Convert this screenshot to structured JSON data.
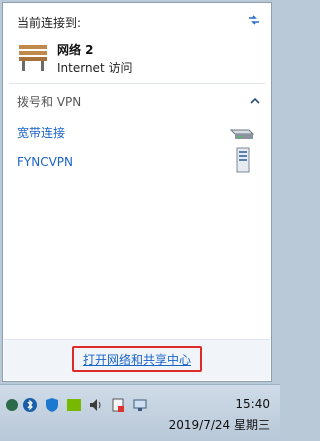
{
  "flyout": {
    "current_title": "当前连接到:",
    "network": {
      "name": "网络  2",
      "status": "Internet 访问"
    },
    "dialup": {
      "header": "拨号和 VPN",
      "items": [
        {
          "label": "宽带连接",
          "icon": "modem-icon"
        },
        {
          "label": "FYNCVPN",
          "icon": "server-icon"
        }
      ]
    },
    "footer_link": "打开网络和共享中心"
  },
  "taskbar": {
    "time": "15:40",
    "date": "2019/7/24 星期三",
    "tray_icons": [
      "app-icon",
      "bluetooth-icon",
      "shield-icon",
      "nvidia-icon",
      "volume-icon",
      "action-center-icon",
      "network-icon"
    ]
  },
  "colors": {
    "link": "#1a64c8",
    "highlight_border": "#e02a2a"
  }
}
